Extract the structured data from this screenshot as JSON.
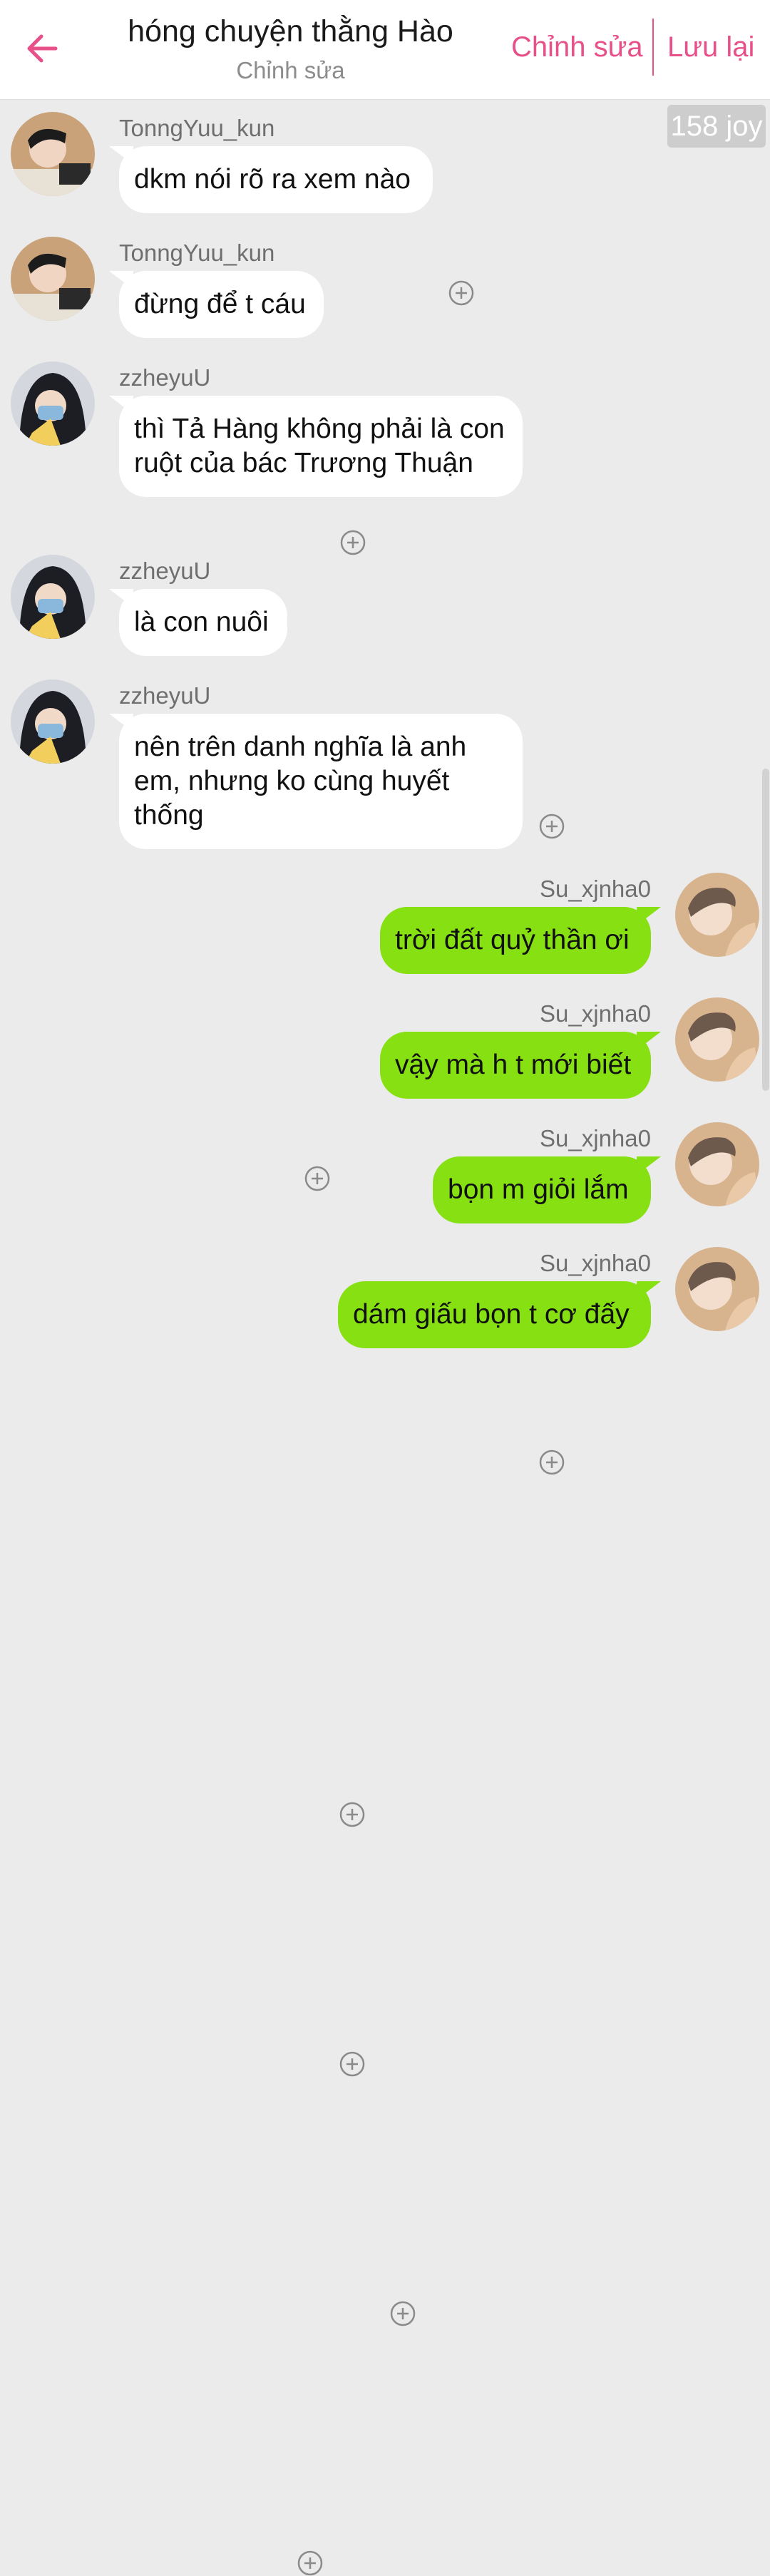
{
  "header": {
    "title": "hóng chuyện thằng Hào",
    "subtitle": "Chỉnh sửa",
    "edit_label": "Chỉnh sửa",
    "save_label": "Lưu lại",
    "accent_color": "#e8508a"
  },
  "joy_badge": "158 joy",
  "messages": [
    {
      "side": "left",
      "user": "TonngYuu_kun",
      "text": "dkm nói rõ ra xem nào",
      "avatar": "avatar-tonngyuu"
    },
    {
      "side": "left",
      "user": "TonngYuu_kun",
      "text": "đừng để t cáu",
      "avatar": "avatar-tonngyuu"
    },
    {
      "side": "left",
      "user": "zzheyuU",
      "text": "thì Tả Hàng không phải là con ruột của bác Trương Thuận",
      "avatar": "avatar-zzheyu"
    },
    {
      "side": "left",
      "user": "zzheyuU",
      "text": "là con nuôi",
      "avatar": "avatar-zzheyu"
    },
    {
      "side": "left",
      "user": "zzheyuU",
      "text": "nên trên danh nghĩa là anh em, nhưng ko cùng huyết thống",
      "avatar": "avatar-zzheyu"
    },
    {
      "side": "right",
      "user": "Su_xjnha0",
      "text": "trời đất quỷ thần ơi",
      "avatar": "avatar-suxjnha"
    },
    {
      "side": "right",
      "user": "Su_xjnha0",
      "text": "vậy mà h t mới biết",
      "avatar": "avatar-suxjnha"
    },
    {
      "side": "right",
      "user": "Su_xjnha0",
      "text": "bọn m giỏi lắm",
      "avatar": "avatar-suxjnha"
    },
    {
      "side": "right",
      "user": "Su_xjnha0",
      "text": "dám giấu bọn t cơ đấy",
      "avatar": "avatar-suxjnha"
    }
  ],
  "colors": {
    "background": "#ebebeb",
    "left_bubble": "#ffffff",
    "right_bubble": "#86e012"
  },
  "icons": {
    "back": "arrow-left-icon",
    "add": "plus-circle-icon"
  }
}
